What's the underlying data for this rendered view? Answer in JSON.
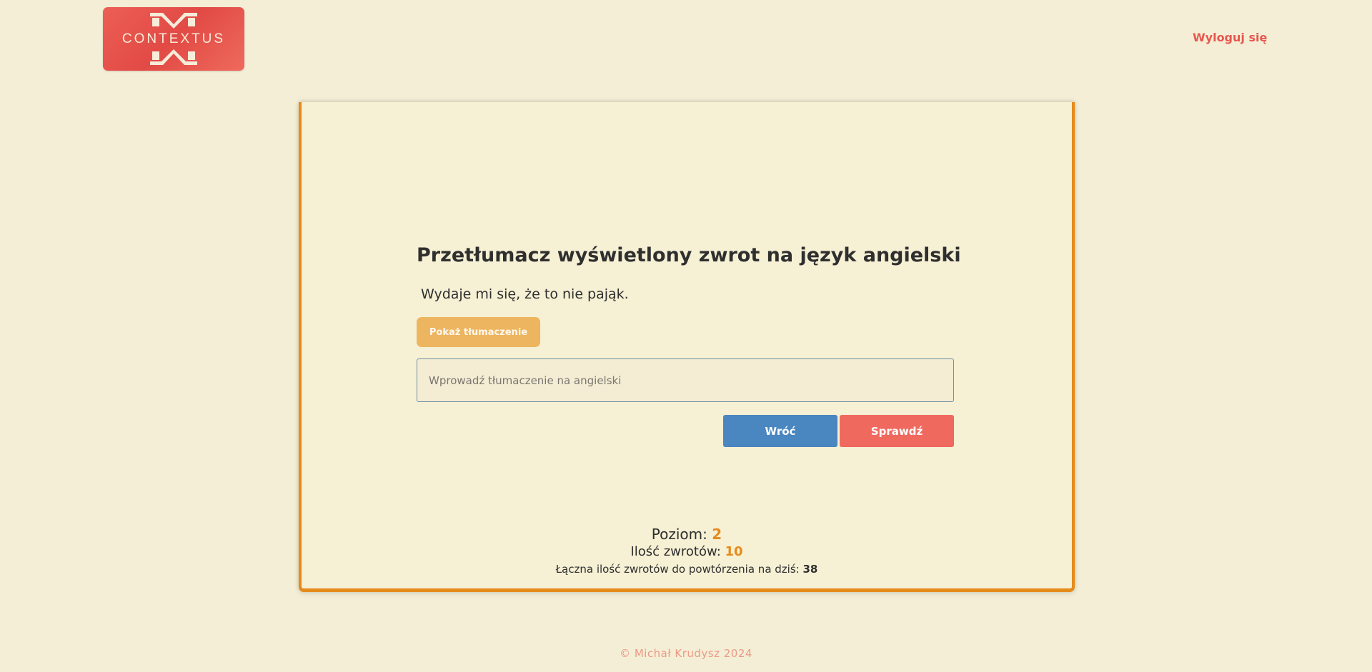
{
  "header": {
    "logo_text": "CONTEXTUS",
    "logout_label": "Wyloguj się"
  },
  "exercise": {
    "heading": "Przetłumacz wyświetlony zwrot na język angielski",
    "phrase": "Wydaje mi się, że to nie pająk.",
    "show_translation_label": "Pokaż tłumaczenie",
    "input_placeholder": "Wprowadź tłumaczenie na angielski",
    "input_value": "",
    "back_label": "Wróć",
    "check_label": "Sprawdź"
  },
  "stats": {
    "level_label": "Poziom:",
    "level_value": "2",
    "phrases_label": "Ilość zwrotów:",
    "phrases_value": "10",
    "total_label": "Łączna ilość zwrotów do powtórzenia na dziś:",
    "total_value": "38"
  },
  "footer": {
    "copyright": "© Michał Krudysz 2024"
  },
  "colors": {
    "background": "#f4eed6",
    "card_border": "#e58b1c",
    "logo": "#e24a45",
    "accent_orange": "#e58b1c",
    "show_button": "#edb55f",
    "back_button": "#4a86c0",
    "check_button": "#f0695f",
    "logout_link": "#e7574f"
  }
}
